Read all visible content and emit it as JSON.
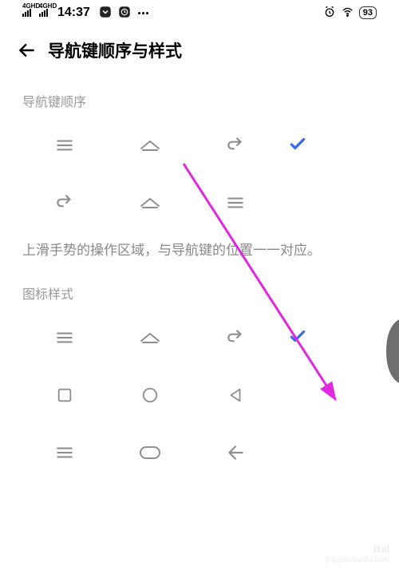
{
  "status": {
    "time": "14:37",
    "net1_label": "4GHD",
    "net2_label": "4GHD",
    "battery": "93"
  },
  "header": {
    "title": "导航键顺序与样式"
  },
  "sections": {
    "order_label": "导航键顺序",
    "style_label": "图标样式"
  },
  "description": "上滑手势的操作区域，与导航键的位置一一对应。",
  "colors": {
    "accent": "#3A6BEB",
    "muted": "#8f8f8f",
    "annotation": "#E028E0"
  },
  "watermark": {
    "line1": "Bai",
    "line2": "jingyan.baidu.com"
  }
}
